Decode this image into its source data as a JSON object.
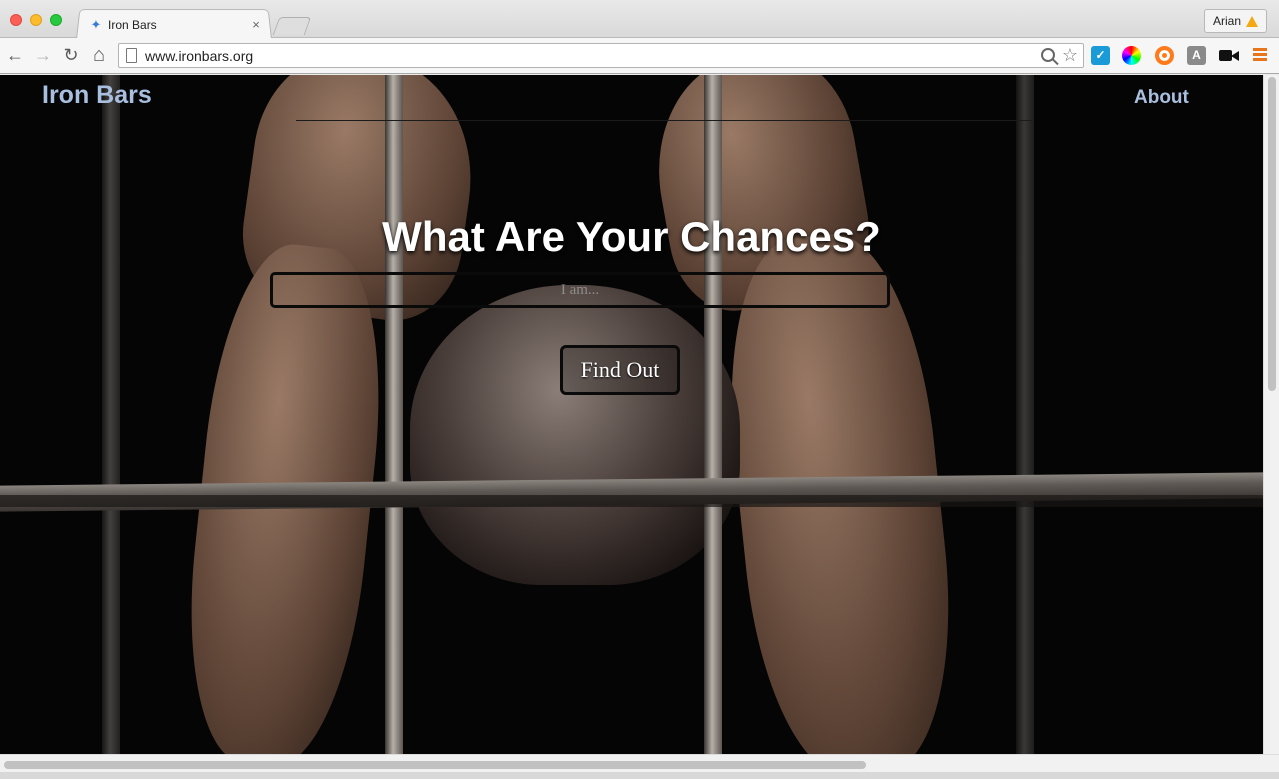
{
  "browser": {
    "tab_title": "Iron Bars",
    "tab_close": "×",
    "profile_name": "Arian",
    "url": "www.ironbars.org",
    "nav": {
      "back": "←",
      "forward": "→",
      "reload": "↻",
      "home": "⌂"
    },
    "star": "☆",
    "extensions": [
      {
        "name": "checkmark-extension-icon",
        "glyph": "✓",
        "color": "#1a9bd7"
      },
      {
        "name": "color-wheel-extension-icon",
        "glyph": "",
        "color": "#ff0000"
      },
      {
        "name": "lifebuoy-extension-icon",
        "glyph": "",
        "color": "#ff7a1a"
      },
      {
        "name": "font-extension-icon",
        "glyph": "A",
        "color": "#8a8a8a"
      },
      {
        "name": "video-camera-extension-icon",
        "glyph": "",
        "color": "#111111"
      }
    ],
    "menu_color": "#e8741b"
  },
  "site": {
    "brand": "Iron Bars",
    "nav_about": "About",
    "headline": "What Are Your Chances?",
    "search_placeholder": "I am...",
    "cta_label": "Find Out",
    "accent_color": "#a8bfe0"
  }
}
